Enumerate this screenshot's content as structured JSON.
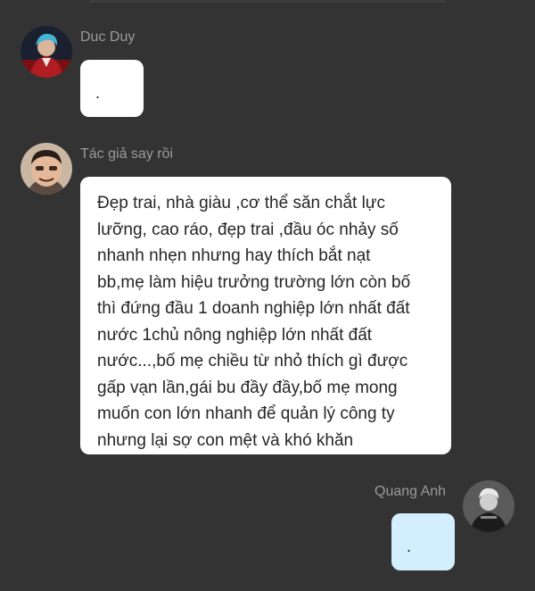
{
  "messages": [
    {
      "sender": "Duc Duy",
      "text": "."
    },
    {
      "sender": "Tác giả say rồi",
      "text": "Đẹp trai, nhà giàu ,cơ thể săn chắt lực\nlưỡng, cao ráo, đẹp trai ,đầu óc nhảy số\nnhanh nhẹn nhưng hay thích bắt nạt\nbb,mẹ làm hiệu trưởng trường lớn còn bố\nthì đứng đầu 1 doanh nghiệp lớn nhất đất\nnước 1chủ nông nghiệp lớn nhất đất\nnước...,bố mẹ chiều từ nhỏ thích gì được\ngấp vạn lần,gái bu đầy đầy,bố mẹ mong\nmuốn con lớn nhanh để quản lý công ty\nnhưng lại sợ con mệt và khó khăn"
    },
    {
      "sender": "Quang Anh",
      "text": "."
    }
  ],
  "colors": {
    "background": "#333333",
    "name_text": "#9a9a9a",
    "incoming_bubble": "#ffffff",
    "outgoing_bubble": "#d3eefc"
  },
  "icons": [
    "avatar-duc-duy",
    "avatar-tac-gia",
    "avatar-quang-anh"
  ]
}
